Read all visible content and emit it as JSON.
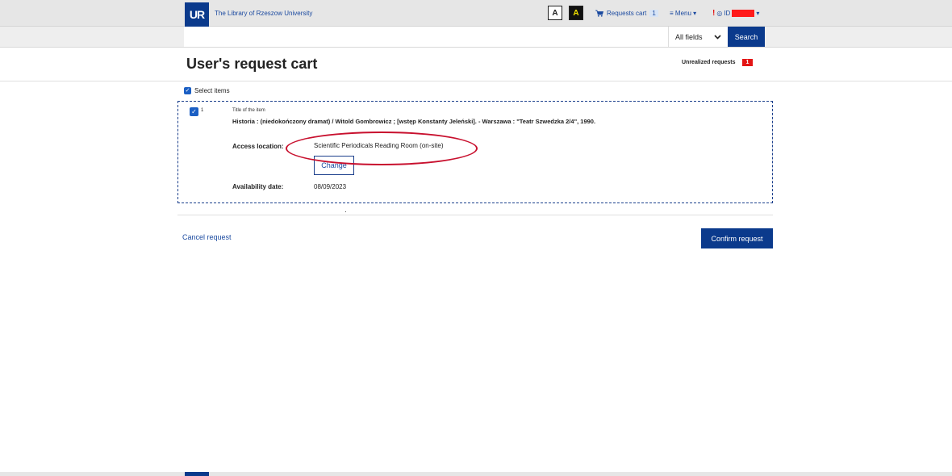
{
  "header": {
    "logo_text": "UR",
    "library_name": "The Library of Rzeszow University",
    "contrast_normal": "A",
    "contrast_high": "A",
    "cart_label": "Requests cart",
    "cart_count": "1",
    "menu_label": "Menu",
    "id_label": "ID"
  },
  "search": {
    "value": "",
    "field_selected": "All fields",
    "button_label": "Search"
  },
  "page": {
    "title": "User's request cart",
    "unrealized_label": "Unrealized requests",
    "unrealized_count": "1"
  },
  "cart": {
    "select_items_label": "Select items",
    "items": [
      {
        "number": "1",
        "title_caption": "Title of the item",
        "title": "Historia : (niedokończony dramat) / Witold Gombrowicz ; [wstęp Konstanty Jeleński]. - Warszawa : \"Teatr Szwedzka 2/4\", 1990.",
        "access_location_label": "Access location:",
        "access_location_value": "Scientific Periodicals Reading Room (on-site)",
        "change_label": "Change",
        "availability_label": "Availability date:",
        "availability_value": "08/09/2023"
      }
    ]
  },
  "actions": {
    "cancel_label": "Cancel request",
    "confirm_label": "Confirm request"
  },
  "colors": {
    "brand_blue": "#0b3a8c",
    "annotation_red": "#c8102e",
    "badge_red": "#e31515"
  }
}
